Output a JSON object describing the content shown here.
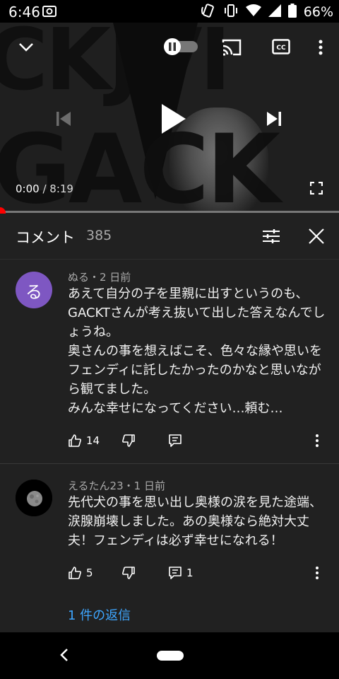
{
  "status_bar": {
    "time": "6:46",
    "battery": "66%"
  },
  "player": {
    "current_time": "0:00",
    "duration": "/ 8:19",
    "art_text_top": "CKJVI",
    "art_text_bottom": "GACK",
    "progress": 0.0
  },
  "comments_panel": {
    "title": "コメント",
    "count": "385"
  },
  "comments": [
    {
      "avatar_letter": "る",
      "avatar_color": "#7e57c2",
      "author_line": "ぬる・2 日前",
      "body": "あえて自分の子を里親に出すというのも、GACKTさんが考え抜いて出した答えなんでしょうね。\n奥さんの事を想えばこそ、色々な縁や思いをフェンディに託したかったのかなと思いながら観てました。\nみんな幸せになってください…頼む…",
      "likes": "14",
      "replies_count": ""
    },
    {
      "avatar_letter": "",
      "avatar_color": "#000000",
      "author_line": "えるたん23・1 日前",
      "body": "先代犬の事を思い出し奥様の涙を見た途端、涙腺崩壊しました。あの奥様なら絶対大丈夫！フェンディは必ず幸せになれる！",
      "likes": "5",
      "replies_count": "1"
    }
  ],
  "replies_link": "1 件の返信",
  "colors": {
    "background": "#212121",
    "accent_red": "#ff0000",
    "link_blue": "#3ea6ff"
  }
}
